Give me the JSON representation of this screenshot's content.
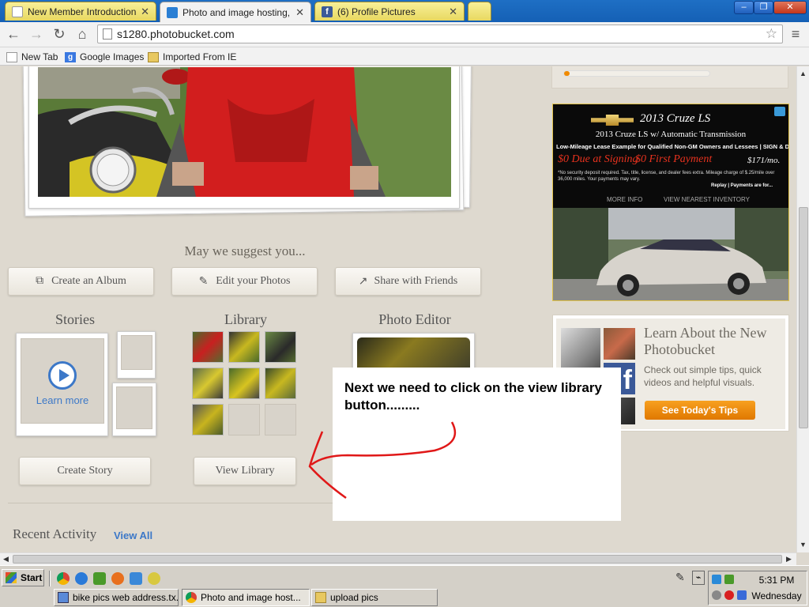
{
  "browser": {
    "tabs": [
      {
        "title": "New Member Introductions -",
        "favicon": "page-icon",
        "active": false
      },
      {
        "title": "Photo and image hosting, fre",
        "favicon": "photobucket-icon",
        "active": true
      },
      {
        "title": "(6) Profile Pictures",
        "favicon": "facebook-icon",
        "active": false
      }
    ],
    "url": "s1280.photobucket.com",
    "bookmarks": [
      {
        "label": "New Tab",
        "icon": "page-icon"
      },
      {
        "label": "Google Images",
        "icon": "google-icon"
      },
      {
        "label": "Imported From IE",
        "icon": "folder-icon"
      }
    ],
    "window_controls": {
      "minimize": "‒",
      "restore": "❐",
      "close": "✕"
    }
  },
  "page": {
    "suggest_heading": "May we suggest you...",
    "suggest_buttons": {
      "album": "Create an Album",
      "edit": "Edit your Photos",
      "share": "Share with Friends"
    },
    "stories": {
      "title": "Stories",
      "learn_more": "Learn more",
      "create_button": "Create Story"
    },
    "library": {
      "title": "Library",
      "view_button": "View Library"
    },
    "photo_editor": {
      "title": "Photo Editor"
    },
    "recent_activity": {
      "title": "Recent Activity",
      "view_all": "View All"
    }
  },
  "ads": {
    "chevy": {
      "model": "2013 Cruze LS",
      "subtitle": "2013 Cruze LS w/ Automatic Transmission",
      "lease_line": "Low-Mileage Lease Example for Qualified Non-GM Owners and Lessees | SIGN & DRIVE LEASE",
      "offer_due": "$0 Due at Signing",
      "offer_payment": "$0 First Payment",
      "monthly": "$171/mo.",
      "fine_print": "*No security deposit required. Tax, title, license, and dealer fees extra. Mileage charge of $.25/mile over 36,000 miles. Your payments may vary.",
      "replay": "Replay | Payments are for...",
      "more_info": "MORE INFO",
      "nearest": "VIEW NEAREST INVENTORY",
      "colors": {
        "bg": "#0a0a0a",
        "red": "#e8321e",
        "gold": "#d8b24a"
      }
    },
    "photobucket_promo": {
      "title": "Learn About the New Photobucket",
      "body": "Check out simple tips, quick videos and helpful visuals.",
      "button": "See Today's Tips",
      "colors": {
        "title": "#6e6a62",
        "button": "#f08a00"
      }
    }
  },
  "annotation": {
    "text": "Next we need to click on the view library button.........",
    "arrow_color": "#e01818"
  },
  "taskbar": {
    "start": "Start",
    "tasks": [
      {
        "label": "bike pics web address.tx...",
        "icon": "notepad-icon",
        "pressed": false
      },
      {
        "label": "Photo and image host...",
        "icon": "chrome-icon",
        "pressed": true
      },
      {
        "label": "upload pics",
        "icon": "folder-icon",
        "pressed": false
      }
    ],
    "time": "5:31 PM",
    "day": "Wednesday"
  }
}
